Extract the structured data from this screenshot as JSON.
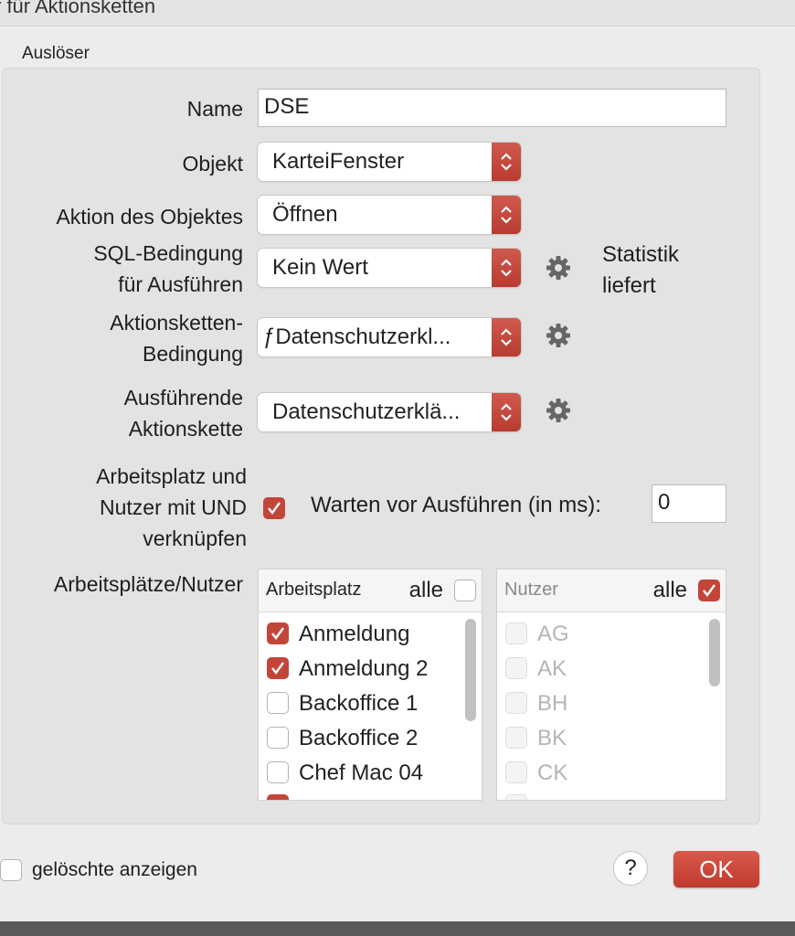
{
  "window": {
    "title": "r für Aktionsketten"
  },
  "group": {
    "label": "Auslöser"
  },
  "form": {
    "name_label": "Name",
    "name_value": "DSE",
    "objekt_label": "Objekt",
    "objekt_value": "KarteiFenster",
    "aktion_label": "Aktion des Objektes",
    "aktion_value": "Öffnen",
    "sql_label_line1": "SQL-Bedingung",
    "sql_label_line2": "für Ausführen",
    "sql_value": "Kein Wert",
    "statistik_line1": "Statistik",
    "statistik_line2": "liefert",
    "ak_bed_label_line1": "Aktionsketten-",
    "ak_bed_label_line2": "Bedingung",
    "ak_bed_value": "ƒDatenschutzerkl...",
    "ausf_label_line1": "Ausführende",
    "ausf_label_line2": "Aktionskette",
    "ausf_value": "Datenschutzerklä...",
    "und_label_line1": "Arbeitsplatz und",
    "und_label_line2": "Nutzer mit UND",
    "und_label_line3": "verknüpfen",
    "und_checked": true,
    "warten_label": "Warten vor Ausführen (in ms):",
    "warten_value": "0",
    "lists_label": "Arbeitsplätze/Nutzer"
  },
  "arbeitsplatz_list": {
    "header": "Arbeitsplatz",
    "alle_label": "alle",
    "alle_checked": false,
    "items": [
      {
        "label": "Anmeldung",
        "checked": true
      },
      {
        "label": "Anmeldung 2",
        "checked": true
      },
      {
        "label": "Backoffice 1",
        "checked": false
      },
      {
        "label": "Backoffice 2",
        "checked": false
      },
      {
        "label": "Chef Mac 04",
        "checked": false
      }
    ]
  },
  "nutzer_list": {
    "header": "Nutzer",
    "alle_label": "alle",
    "alle_checked": true,
    "items": [
      {
        "label": "AG"
      },
      {
        "label": "AK"
      },
      {
        "label": "BH"
      },
      {
        "label": "BK"
      },
      {
        "label": "CK"
      }
    ]
  },
  "footer": {
    "show_deleted_label": "gelöschte anzeigen",
    "show_deleted_checked": false,
    "help_label": "?",
    "ok_label": "OK"
  },
  "colors": {
    "accent": "#c2453a",
    "panel": "#e3e3e3",
    "background": "#ececec"
  }
}
